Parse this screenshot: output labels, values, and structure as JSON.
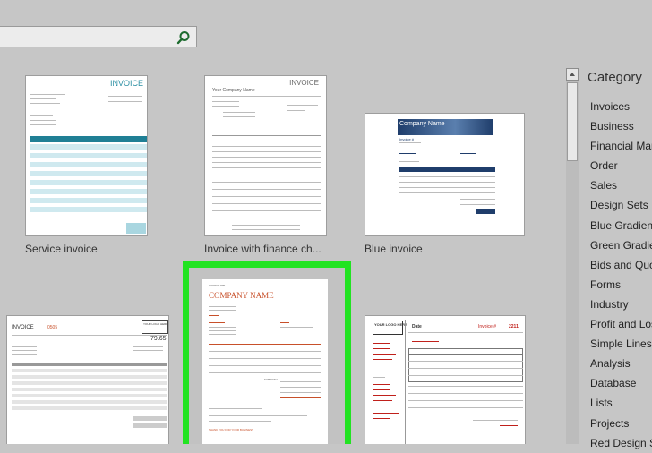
{
  "search": {
    "value": ""
  },
  "templates": [
    {
      "label": "Service invoice",
      "title": "INVOICE"
    },
    {
      "label": "Invoice with finance ch...",
      "title": "INVOICE",
      "company": "Your Company Name"
    },
    {
      "label": "Blue invoice",
      "company": "Company Name",
      "header": "Invoice #"
    },
    {
      "label": "",
      "title": "INVOICE",
      "number": "0505",
      "logo": "YOUR LOGO HERE",
      "total": "79.65"
    },
    {
      "label": "",
      "title": "INVOICE #00",
      "company": "COMPANY NAME",
      "total_label": "SUBTOTAL",
      "footer": "THANK YOU FOR YOUR BUSINESS"
    },
    {
      "label": "",
      "logo": "YOUR LOGO HERE",
      "date": "Date",
      "invoice_label": "Invoice #",
      "invoice_number": "2211"
    }
  ],
  "category": {
    "title": "Category",
    "items": [
      "Invoices",
      "Business",
      "Financial Mana",
      "Order",
      "Sales",
      "Design Sets",
      "Blue Gradient D",
      "Green Gradient",
      "Bids and Quote",
      "Forms",
      "Industry",
      "Profit and Loss",
      "Simple Lines D",
      "Analysis",
      "Database",
      "Lists",
      "Projects",
      "Red Design Se"
    ]
  },
  "colors": {
    "selection": "#22e322",
    "teal": "#2b8fa3",
    "navy": "#1f3d6b",
    "orange": "#c8502a",
    "red": "#c0201b"
  }
}
